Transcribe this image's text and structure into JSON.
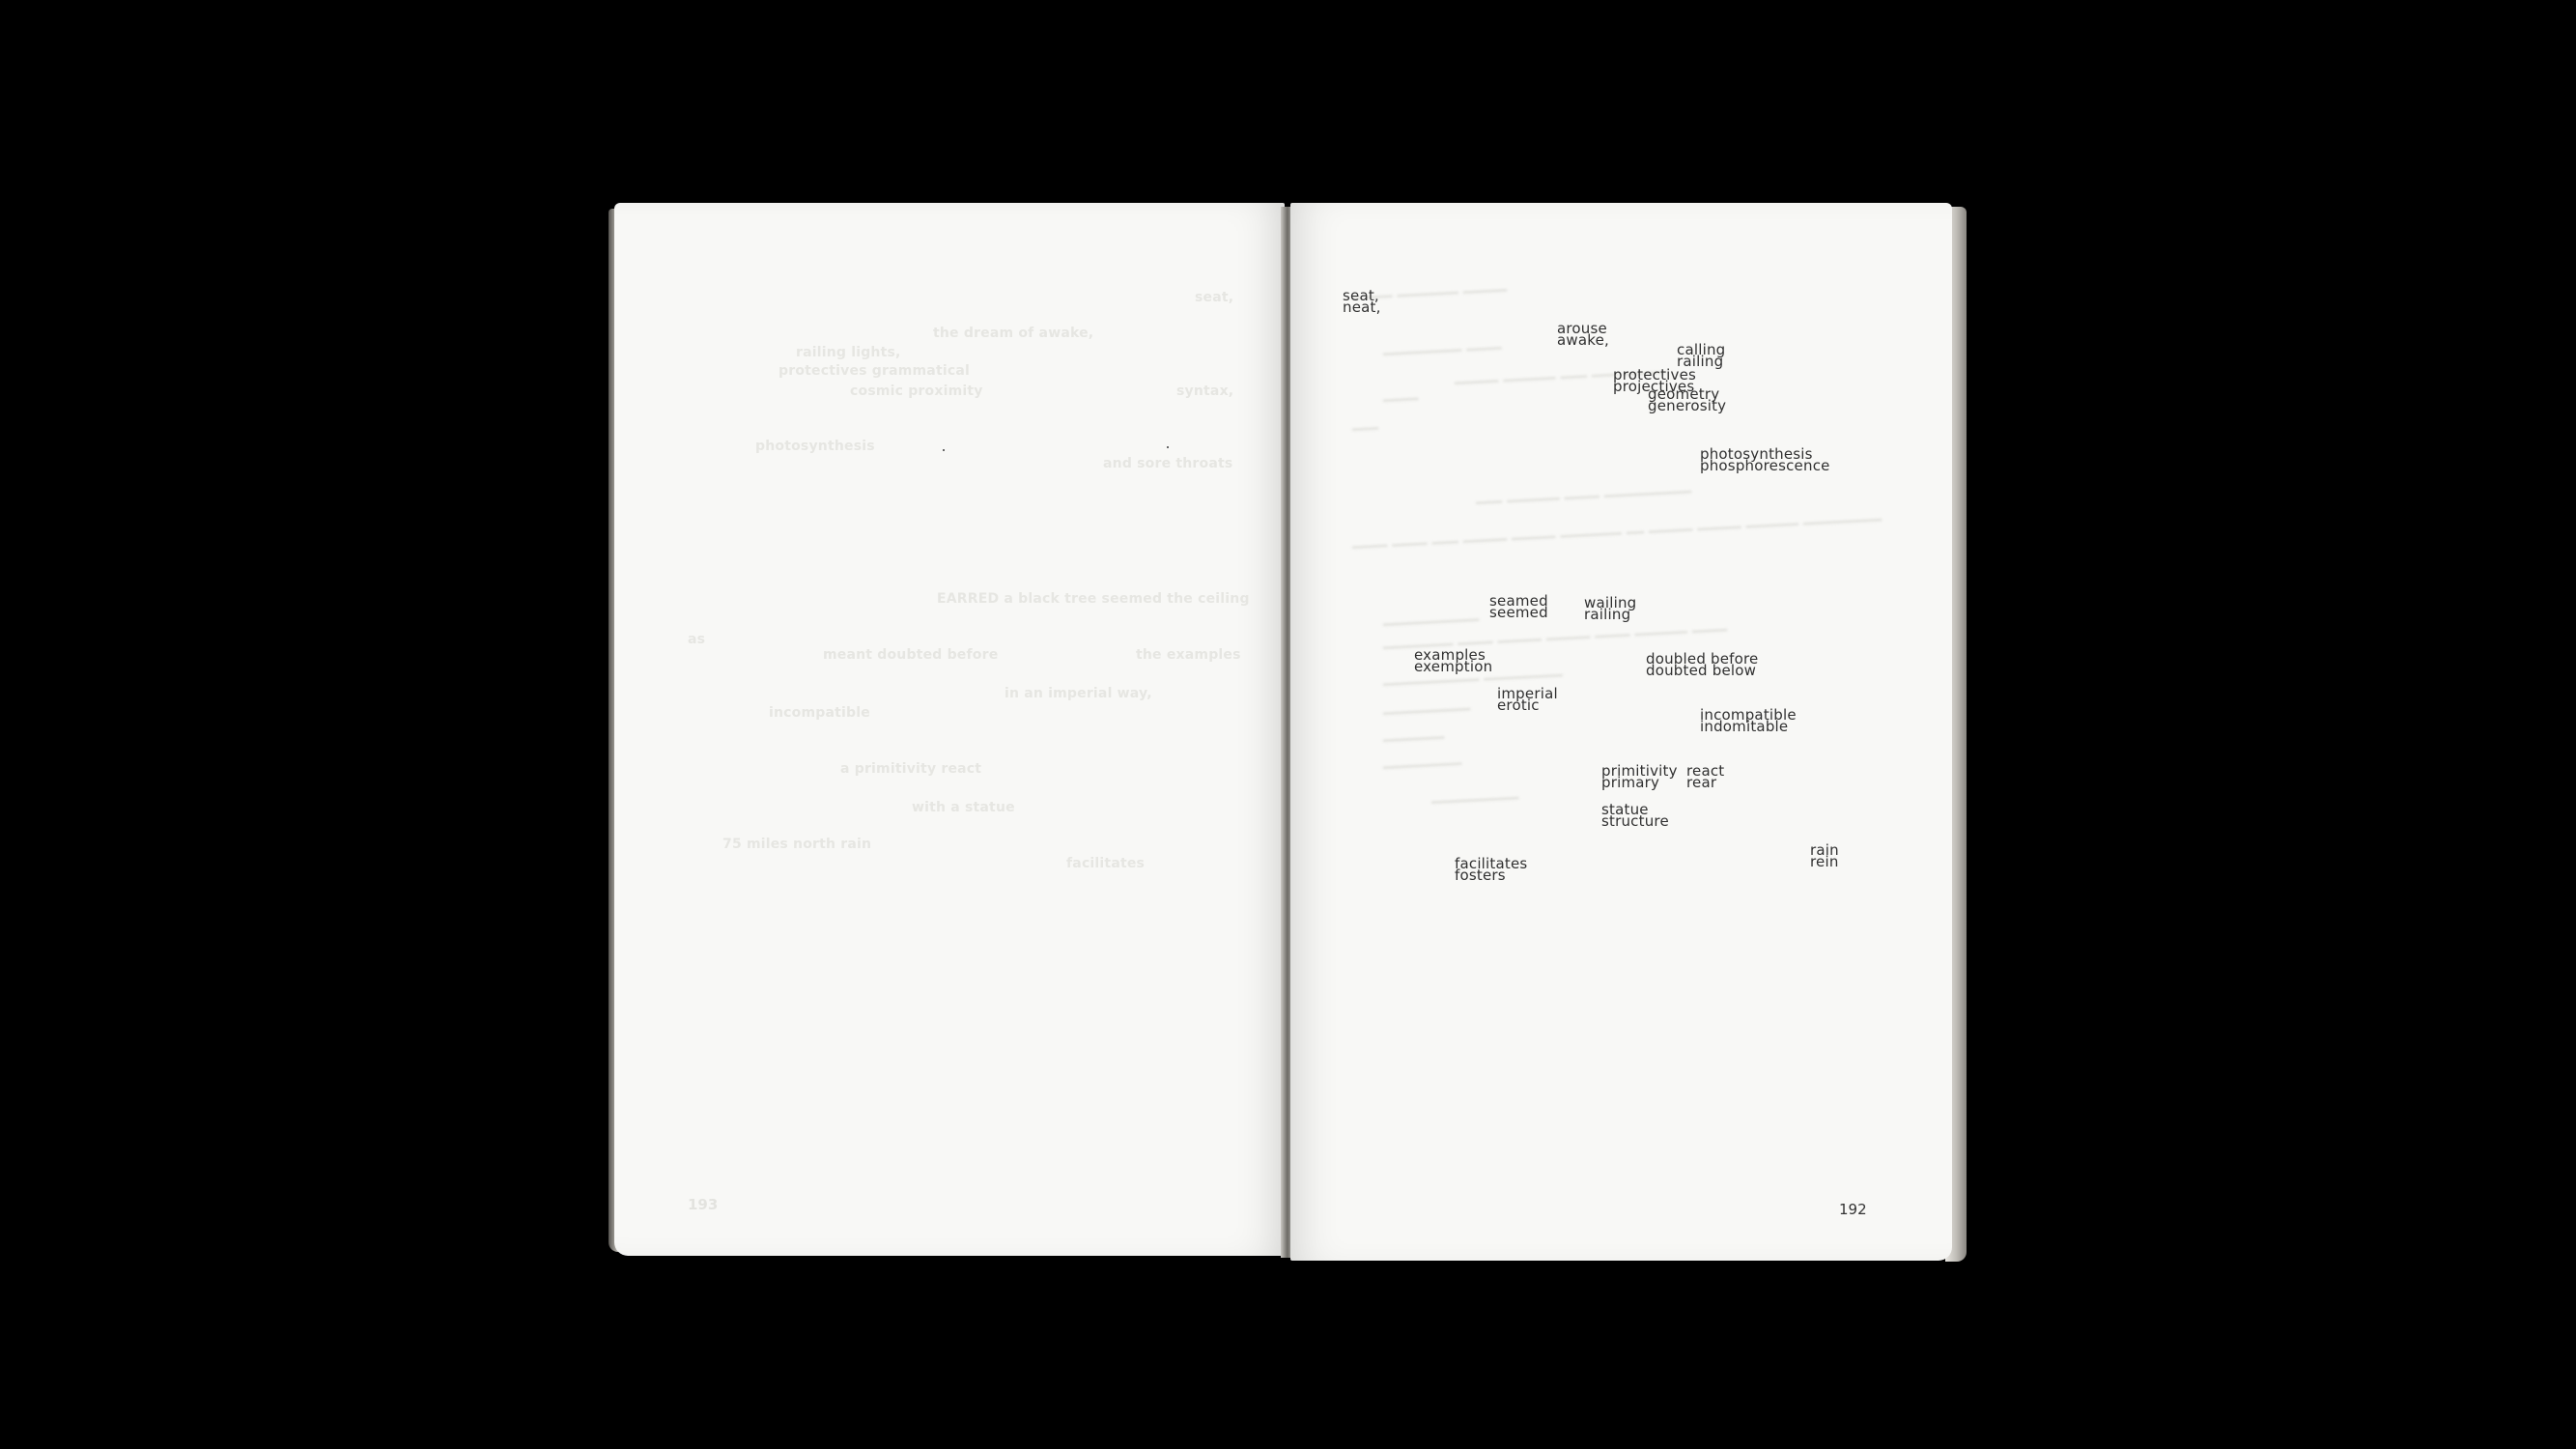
{
  "right_page": {
    "page_number": "192",
    "words": [
      {
        "top": "seat,",
        "bottom": "neat,"
      },
      {
        "top": "arouse",
        "bottom": "awake,"
      },
      {
        "top": "calling",
        "bottom": "railing"
      },
      {
        "top": "protectives",
        "bottom": "projectives"
      },
      {
        "top": "geometry",
        "bottom": "generosity"
      },
      {
        "top": "photosynthesis",
        "bottom": "phosphorescence"
      },
      {
        "top": "seamed",
        "bottom": "seemed"
      },
      {
        "top": "wailing",
        "bottom": "railing"
      },
      {
        "top": "examples",
        "bottom": "exemption"
      },
      {
        "top": "doubled before",
        "bottom": "doubted below"
      },
      {
        "top": "imperial",
        "bottom": "erotic"
      },
      {
        "top": "incompatible",
        "bottom": "indomitable"
      },
      {
        "top": "primitivity",
        "bottom": "primary"
      },
      {
        "top": "react",
        "bottom": "rear"
      },
      {
        "top": "statue",
        "bottom": "structure"
      },
      {
        "top": "facilitates",
        "bottom": "fosters"
      },
      {
        "top": "rain",
        "bottom": "rein"
      }
    ]
  },
  "left_page": {
    "page_number": "193",
    "ghost_lines": [
      "seat,",
      "the dream of awake,",
      "railing lights,",
      "protectives grammatical",
      "syntax,",
      "cosmic proximity",
      "photosynthesis",
      "and sore throats",
      "EARRED a black tree seemed the ceiling",
      "as",
      "the examples",
      "meant doubted before",
      "in an imperial way,",
      "incompatible",
      "a primitivity react",
      "with a statue",
      "75 miles north rain",
      "facilitates"
    ]
  }
}
